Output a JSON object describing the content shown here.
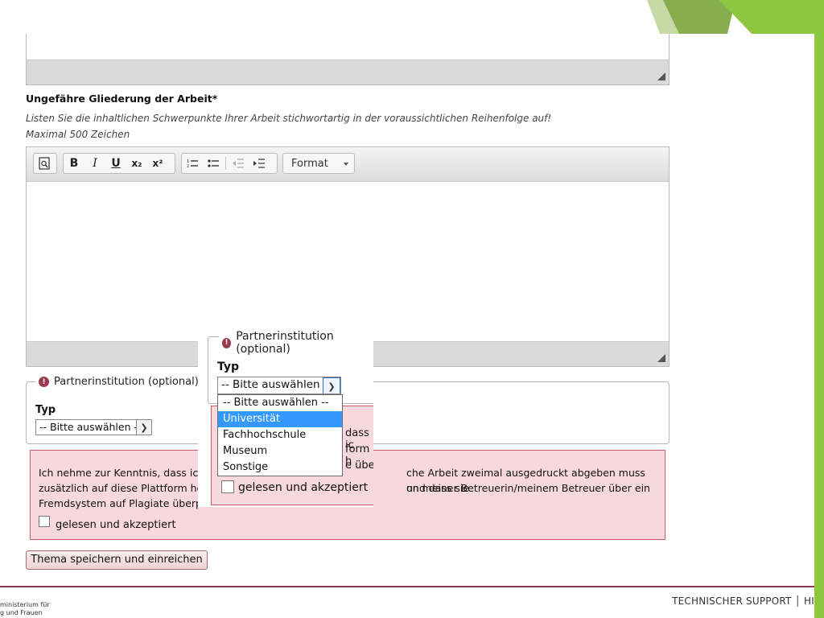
{
  "section": {
    "heading": "Ungefähre Gliederung der Arbeit*",
    "hint_line1": "Listen Sie die inhaltlichen Schwerpunkte Ihrer Arbeit stichwortartig in der voraussichtlichen Reihenfolge auf!",
    "hint_line2": "Maximal 500 Zeichen"
  },
  "toolbar": {
    "preview_icon": "preview-icon",
    "bold": "B",
    "italic": "I",
    "underline": "U",
    "subscript": "x₂",
    "superscript": "x²",
    "format_label": "Format"
  },
  "partner": {
    "legend": "Partnerinstitution (optional)",
    "typ_label": "Typ",
    "select_value": "-- Bitte auswählen --"
  },
  "dropdown": {
    "legend": "Partnerinstitution (optional)",
    "typ_label": "Typ",
    "select_value": "-- Bitte auswählen --",
    "options": [
      "-- Bitte auswählen --",
      "Universität",
      "Fachhochschule",
      "Museum",
      "Sonstige"
    ],
    "selected_option": "Universität",
    "notice_fragments": [
      "dass ic",
      "form h",
      "e über"
    ],
    "checkbox_label": "gelesen und akzeptiert"
  },
  "notice": {
    "line1_left": "Ich nehme zur Kenntnis, dass ich n",
    "line1_right": "che Arbeit zweimal ausgedruckt abgeben muss und dass sie",
    "line2_left": "zusätzlich auf diese Plattform hoch",
    "line2_right": "on meiner Betreuerin/meinem Betreuer über ein",
    "line3_left": "Fremdsystem auf Plagiate überprü",
    "checkbox_label": "gelesen und akzeptiert"
  },
  "submit_label": "Thema speichern und einreichen",
  "footer": {
    "left_line1": "ministerium für",
    "left_line2": "g und Frauen",
    "right": "TECHNISCHER SUPPORT  │  HI"
  },
  "colors": {
    "accent_green": "#8dc63f",
    "footer_line": "#8c3650",
    "notice_bg": "#f7d9dd",
    "selected_option_bg": "#3399ff"
  }
}
